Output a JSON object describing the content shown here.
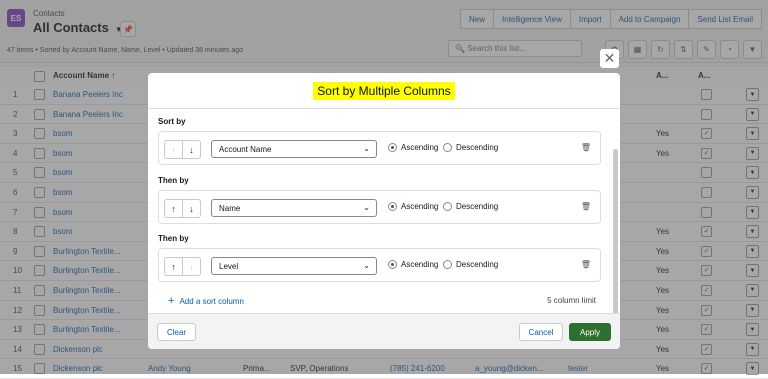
{
  "header": {
    "object_icon": "contacts-icon",
    "object_icon_text": "ES",
    "object_label": "Contacts",
    "list_title": "All Contacts",
    "meta": "47 items • Sorted by Account Name, Name, Level • Updated 38 minutes ago",
    "buttons": [
      "New",
      "Intelligence View",
      "Import",
      "Add to Campaign",
      "Send List Email"
    ],
    "search_placeholder": "Search this list..."
  },
  "table": {
    "col_account": "Account Name ↑",
    "col_a1": "A...",
    "col_a2": "A...",
    "rows": [
      {
        "num": "1",
        "account": "Banana Peelers Inc",
        "c2": "",
        "c3": "",
        "c4": "",
        "c5": "",
        "c6": "",
        "c7": "",
        "yes": "",
        "check": ""
      },
      {
        "num": "2",
        "account": "Banana Peelers Inc",
        "c2": "",
        "c3": "",
        "c4": "",
        "c5": "",
        "c6": "",
        "c7": "",
        "yes": "",
        "check": ""
      },
      {
        "num": "3",
        "account": "bsom",
        "c2": "",
        "c3": "",
        "c4": "",
        "c5": "",
        "c6": "",
        "c7": "",
        "yes": "Yes",
        "check": "✓"
      },
      {
        "num": "4",
        "account": "bsom",
        "c2": "",
        "c3": "",
        "c4": "",
        "c5": "",
        "c6": "",
        "c7": "",
        "yes": "Yes",
        "check": "✓"
      },
      {
        "num": "5",
        "account": "bsom",
        "c2": "",
        "c3": "",
        "c4": "",
        "c5": "",
        "c6": "",
        "c7": "",
        "yes": "",
        "check": ""
      },
      {
        "num": "6",
        "account": "bsom",
        "c2": "",
        "c3": "",
        "c4": "",
        "c5": "",
        "c6": "",
        "c7": "",
        "yes": "",
        "check": ""
      },
      {
        "num": "7",
        "account": "bsom",
        "c2": "",
        "c3": "",
        "c4": "",
        "c5": "",
        "c6": "",
        "c7": "",
        "yes": "",
        "check": ""
      },
      {
        "num": "8",
        "account": "bsom",
        "c2": "",
        "c3": "",
        "c4": "",
        "c5": "",
        "c6": "",
        "c7": "",
        "yes": "Yes",
        "check": "✓"
      },
      {
        "num": "9",
        "account": "Burlington Textile...",
        "c2": "",
        "c3": "",
        "c4": "",
        "c5": "",
        "c6": "",
        "c7": "",
        "yes": "Yes",
        "check": "✓"
      },
      {
        "num": "10",
        "account": "Burlington Textile...",
        "c2": "",
        "c3": "",
        "c4": "",
        "c5": "",
        "c6": "",
        "c7": "",
        "yes": "Yes",
        "check": "✓"
      },
      {
        "num": "11",
        "account": "Burlington Textile...",
        "c2": "",
        "c3": "",
        "c4": "",
        "c5": "",
        "c6": "",
        "c7": "",
        "yes": "Yes",
        "check": "✓"
      },
      {
        "num": "12",
        "account": "Burlington Textile...",
        "c2": "",
        "c3": "",
        "c4": "",
        "c5": "",
        "c6": "",
        "c7": "",
        "yes": "Yes",
        "check": "✓"
      },
      {
        "num": "13",
        "account": "Burlington Textile...",
        "c2": "",
        "c3": "",
        "c4": "",
        "c5": "",
        "c6": "",
        "c7": "",
        "yes": "Yes",
        "check": "✓"
      },
      {
        "num": "14",
        "account": "Dickenson plc",
        "c2": "",
        "c3": "",
        "c4": "",
        "c5": "",
        "c6": "",
        "c7": "",
        "yes": "Yes",
        "check": "✓"
      },
      {
        "num": "15",
        "account": "Dickenson plc",
        "c2": "Andy Young",
        "c3": "Prima...",
        "c4": "SVP, Operations",
        "c5": "(785) 241-6200",
        "c6": "a_young@dicken...",
        "c7": "tester",
        "yes": "Yes",
        "check": "✓"
      }
    ]
  },
  "modal": {
    "title": "Sort by Multiple Columns",
    "close_icon": "close-icon",
    "sections": [
      {
        "label": "Sort by",
        "field": "Account Name",
        "up_enabled": false,
        "down_enabled": true,
        "ascending": "Ascending",
        "descending": "Descending",
        "selected": "Ascending"
      },
      {
        "label": "Then by",
        "field": "Name",
        "up_enabled": true,
        "down_enabled": true,
        "ascending": "Ascending",
        "descending": "Descending",
        "selected": "Ascending"
      },
      {
        "label": "Then by",
        "field": "Level",
        "up_enabled": true,
        "down_enabled": false,
        "ascending": "Ascending",
        "descending": "Descending",
        "selected": "Ascending"
      }
    ],
    "add_label": "Add a sort column",
    "limit": "5 column limit",
    "clear": "Clear",
    "cancel": "Cancel",
    "apply": "Apply"
  },
  "colors": {
    "accent": "#0b5cab",
    "apply": "#2e6e2e",
    "highlight": "#ffff00"
  }
}
